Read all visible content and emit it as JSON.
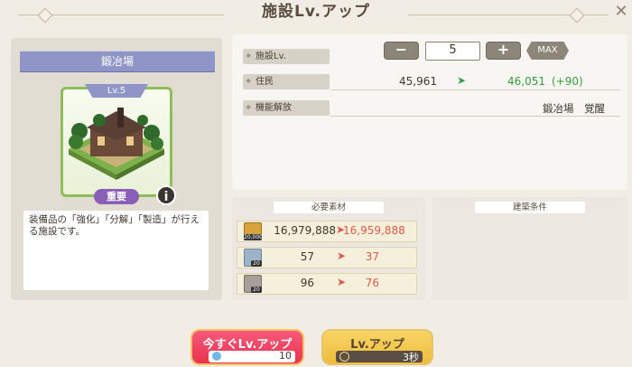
{
  "header": {
    "title": "施設Lv.アップ",
    "close_icon": "close-x-icon"
  },
  "facility": {
    "name": "鍛冶場",
    "level_tag": "Lv.5",
    "badge": "重要",
    "info_icon": "i",
    "description": "装備品の「強化」「分解」「製造」が行える施設です。"
  },
  "levelup": {
    "label": "施設Lv.",
    "minus_label": "−",
    "value": "5",
    "plus_label": "+",
    "max_label": "MAX"
  },
  "residents": {
    "label": "住民",
    "current": "45,961",
    "next": "46,051",
    "delta": "(+90)"
  },
  "unlocks": {
    "label": "機能解放",
    "value": "鍛冶場　覚醒"
  },
  "materials": {
    "header": "必要素材",
    "items": [
      {
        "icon": "gold-coin-icon",
        "qty": "20,000",
        "have": "16,979,888",
        "after": "16,959,888"
      },
      {
        "icon": "ore-icon",
        "qty": "20",
        "have": "57",
        "after": "37"
      },
      {
        "icon": "ingot-icon",
        "qty": "20",
        "have": "96",
        "after": "76"
      }
    ]
  },
  "conditions": {
    "header": "建築条件"
  },
  "buttons": {
    "instant_label": "今すぐLv.アップ",
    "instant_cost": "10",
    "instant_icon": "gem-icon",
    "levelup_label": "Lv.アップ",
    "levelup_time": "3秒",
    "levelup_icon": "clock-icon"
  },
  "colors": {
    "accent_green": "#3a9a3c",
    "accent_red": "#e05a4a",
    "banner": "#8f96c7"
  }
}
